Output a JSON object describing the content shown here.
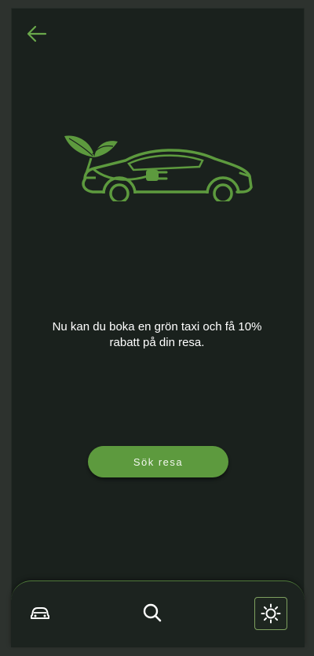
{
  "header": {
    "back_icon": "arrow-left-icon"
  },
  "hero": {
    "illustration_icon": "eco-electric-car-illustration"
  },
  "main": {
    "message": "Nu kan du boka en grön taxi och få 10%\nrabatt på din resa."
  },
  "actions": {
    "search_trip_label": "Sök resa"
  },
  "bottom_nav": {
    "items": [
      {
        "icon": "car-icon"
      },
      {
        "icon": "search-icon"
      },
      {
        "icon": "sun-icon",
        "active": true
      }
    ]
  },
  "colors": {
    "background": "#1a211d",
    "accent": "#5d9a3e",
    "text": "#ffffff"
  }
}
